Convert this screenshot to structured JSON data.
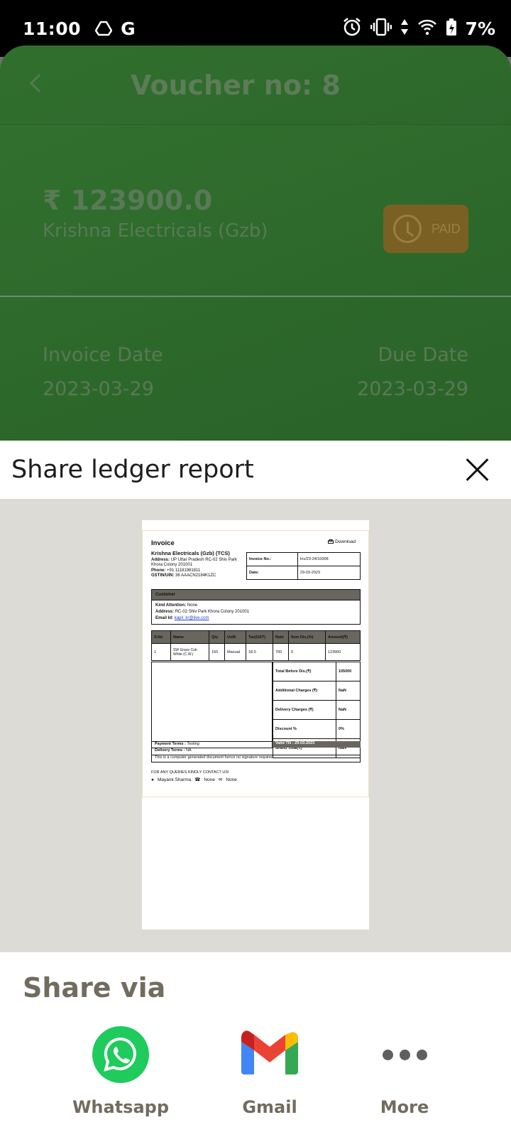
{
  "status_bar": {
    "time": "11:00",
    "battery": "7%",
    "g_label": "G"
  },
  "background_app": {
    "title": "Voucher no: 8",
    "amount": "₹ 123900.0",
    "party": "Krishna Electricals (Gzb)",
    "paid_badge": "PAID",
    "invoice_date_label": "Invoice Date",
    "invoice_date": "2023-03-29",
    "due_date_label": "Due Date",
    "due_date": "2023-03-29"
  },
  "sheet": {
    "title": "Share ledger report"
  },
  "invoice": {
    "heading": "Invoice",
    "download": "Download",
    "company": "Krishna Electricals (Gzb) (TCS)",
    "address_label": "Address:",
    "address": "UP Uttar Pradesh RC-02 Shiv Park Khora Colony 201001",
    "phone_label": "Phone:",
    "phone": "+91 11181981811",
    "gstin_label": "GSTIN/UIN:",
    "gstin": "36 AAACN2184K1ZC",
    "invoice_no_label": "Invoice No.:",
    "invoice_no": "Inv/23-24/10008",
    "date_label": "Date:",
    "date": "29-03-2023",
    "customer_label": "Customer",
    "kind_attention_label": "Kind Attention:",
    "kind_attention": "None",
    "cust_address_label": "Address:",
    "cust_address": "RC-02 Shiv Park Khora Colony 201001",
    "email_label": "Email Id:",
    "email": "kapil_kr@live.com",
    "columns": [
      "S.No",
      "Name",
      "Qty",
      "UoM",
      "Tax(GST)",
      "Rate",
      "Item Dis.(%)",
      "Amount(₹)"
    ],
    "row": [
      "1",
      "SW Grace Cob White (C.W.)",
      "150",
      "Manual",
      "18.0",
      "700",
      "0",
      "123900"
    ],
    "totals": [
      {
        "label": "Total Before Dis.(₹)",
        "value": "105000"
      },
      {
        "label": "Additional Charges (₹)",
        "value": "NaN"
      },
      {
        "label": "Delivery Charges (₹)",
        "value": "NaN"
      },
      {
        "label": "Discount %",
        "value": "0%"
      },
      {
        "label": "Grand Total(₹)",
        "value": "NaN"
      }
    ],
    "valid_till": "Valid Till : 29-03-2023",
    "payment_terms_label": "Payment Terms :",
    "payment_terms": "Testing",
    "delivery_terms_label": "Delivery Terms :",
    "delivery_terms": "NA",
    "note": "This is a computer generated document hence no signature required.",
    "queries": "FOR ANY QUERIES KINDLY CONTACT US!",
    "contact_name": "Mayank Sharma",
    "contact_phone": "None",
    "contact_email": "None"
  },
  "share": {
    "title": "Share via",
    "options": [
      {
        "label": "Whatsapp",
        "icon": "whatsapp-icon"
      },
      {
        "label": "Gmail",
        "icon": "gmail-icon"
      },
      {
        "label": "More",
        "icon": "more-dots-icon"
      }
    ]
  },
  "colors": {
    "whatsapp": "#1fcb5d",
    "paid_badge": "#7b6023",
    "app_green": "#2e6a2c"
  }
}
